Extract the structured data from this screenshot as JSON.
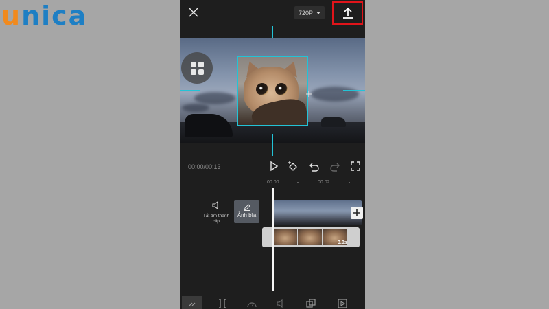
{
  "watermark": {
    "logo_u": "u",
    "logo_rest": "nica"
  },
  "topbar": {
    "close_icon": "close-icon",
    "resolution": "720P",
    "export_icon": "upload-icon"
  },
  "controls": {
    "time": "00:00/00:13",
    "icons": [
      "play-icon",
      "keyframe-icon",
      "undo-icon",
      "redo-icon",
      "fullscreen-icon"
    ]
  },
  "ruler": {
    "marks": [
      "00:00",
      "00:02"
    ]
  },
  "timeline": {
    "mute_label": "Tắt âm thanh clip",
    "cover_label": "Ảnh bìa",
    "clip_duration": "3.0s"
  },
  "tabbar": {
    "icons": [
      "collapse-icon",
      "split-icon",
      "speed-icon",
      "volume-icon",
      "overlay-icon",
      "animation-icon"
    ]
  },
  "colors": {
    "accent": "#23c3d6",
    "highlight": "#e0141a",
    "logo_orange": "#f18a1e",
    "logo_blue": "#1e7fc4"
  }
}
